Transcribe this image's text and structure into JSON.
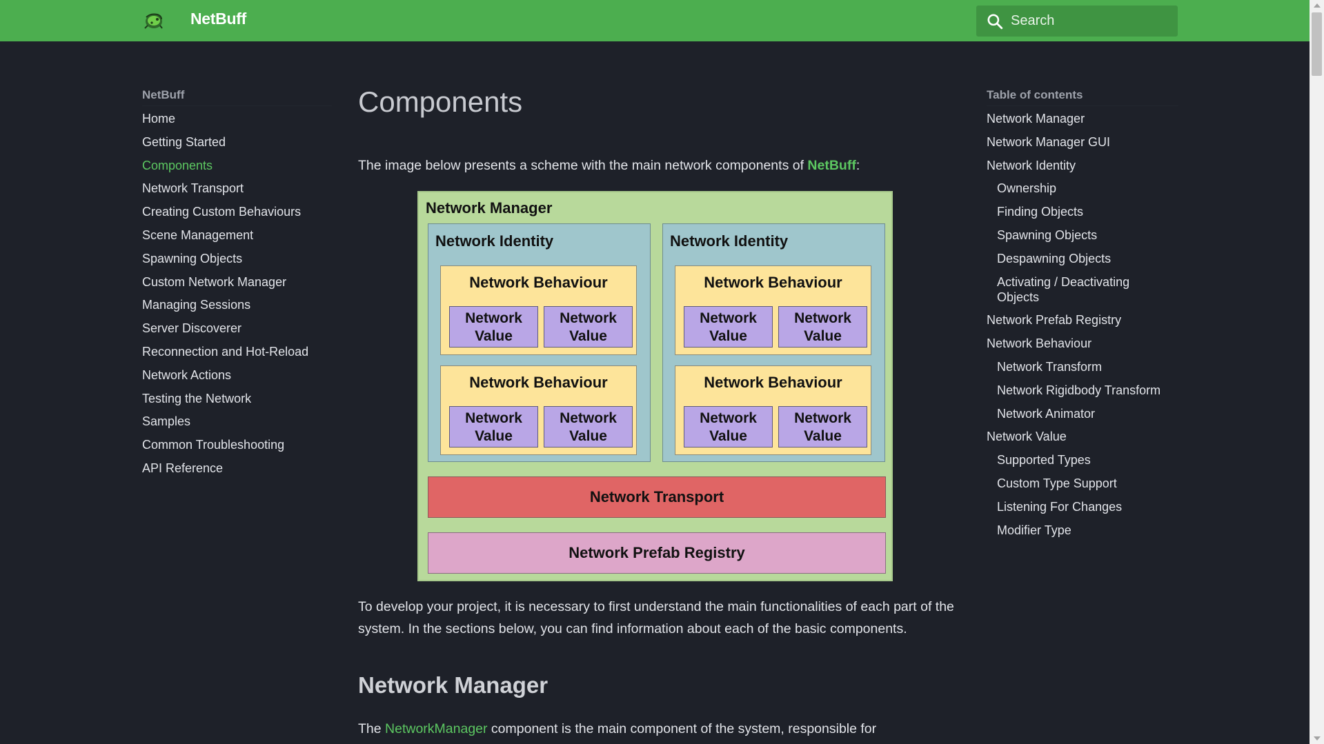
{
  "header": {
    "site_title": "NetBuff",
    "search_placeholder": "Search",
    "brand_color": "#4cae4f"
  },
  "nav": {
    "title": "NetBuff",
    "items": [
      {
        "label": "Home"
      },
      {
        "label": "Getting Started"
      },
      {
        "label": "Components",
        "active": true
      },
      {
        "label": "Network Transport"
      },
      {
        "label": "Creating Custom Behaviours"
      },
      {
        "label": "Scene Management"
      },
      {
        "label": "Spawning Objects"
      },
      {
        "label": "Custom Network Manager"
      },
      {
        "label": "Managing Sessions"
      },
      {
        "label": "Server Discoverer"
      },
      {
        "label": "Reconnection and Hot-Reload"
      },
      {
        "label": "Network Actions"
      },
      {
        "label": "Testing the Network"
      },
      {
        "label": "Samples"
      },
      {
        "label": "Common Troubleshooting"
      },
      {
        "label": "API Reference"
      }
    ]
  },
  "main": {
    "title": "Components",
    "intro_before": "The image below presents a scheme with the main network components of ",
    "intro_link": "NetBuff",
    "intro_after": ":",
    "paragraph2": "To develop your project, it is necessary to first understand the main functionalities of each part of the system. In the sections below, you can find information about each of the basic components.",
    "section_heading": "Network Manager",
    "p3_before": "The ",
    "p3_link": "NetworkManager",
    "p3_after": " component is the main component of the system, responsible for"
  },
  "diagram": {
    "manager_label": "Network Manager",
    "identity_label": "Network Identity",
    "behaviour_label": "Network Behaviour",
    "value_line1": "Network",
    "value_line2": "Value",
    "transport_label": "Network Transport",
    "registry_label": "Network Prefab Registry",
    "colors": {
      "manager": "#b8d99b",
      "identity": "#9fc6cc",
      "behaviour": "#fde49a",
      "value": "#b9a6e6",
      "transport": "#e06565",
      "registry": "#dda6c9"
    }
  },
  "toc": {
    "title": "Table of contents",
    "items": [
      {
        "label": "Network Manager",
        "level": 1
      },
      {
        "label": "Network Manager GUI",
        "level": 1
      },
      {
        "label": "Network Identity",
        "level": 1
      },
      {
        "label": "Ownership",
        "level": 2
      },
      {
        "label": "Finding Objects",
        "level": 2
      },
      {
        "label": "Spawning Objects",
        "level": 2
      },
      {
        "label": "Despawning Objects",
        "level": 2
      },
      {
        "label": "Activating / Deactivating Objects",
        "level": 2
      },
      {
        "label": "Network Prefab Registry",
        "level": 1
      },
      {
        "label": "Network Behaviour",
        "level": 1
      },
      {
        "label": "Network Transform",
        "level": 2
      },
      {
        "label": "Network Rigidbody Transform",
        "level": 2
      },
      {
        "label": "Network Animator",
        "level": 2
      },
      {
        "label": "Network Value",
        "level": 1
      },
      {
        "label": "Supported Types",
        "level": 2
      },
      {
        "label": "Custom Type Support",
        "level": 2
      },
      {
        "label": "Listening For Changes",
        "level": 2
      },
      {
        "label": "Modifier Type",
        "level": 2
      }
    ]
  }
}
